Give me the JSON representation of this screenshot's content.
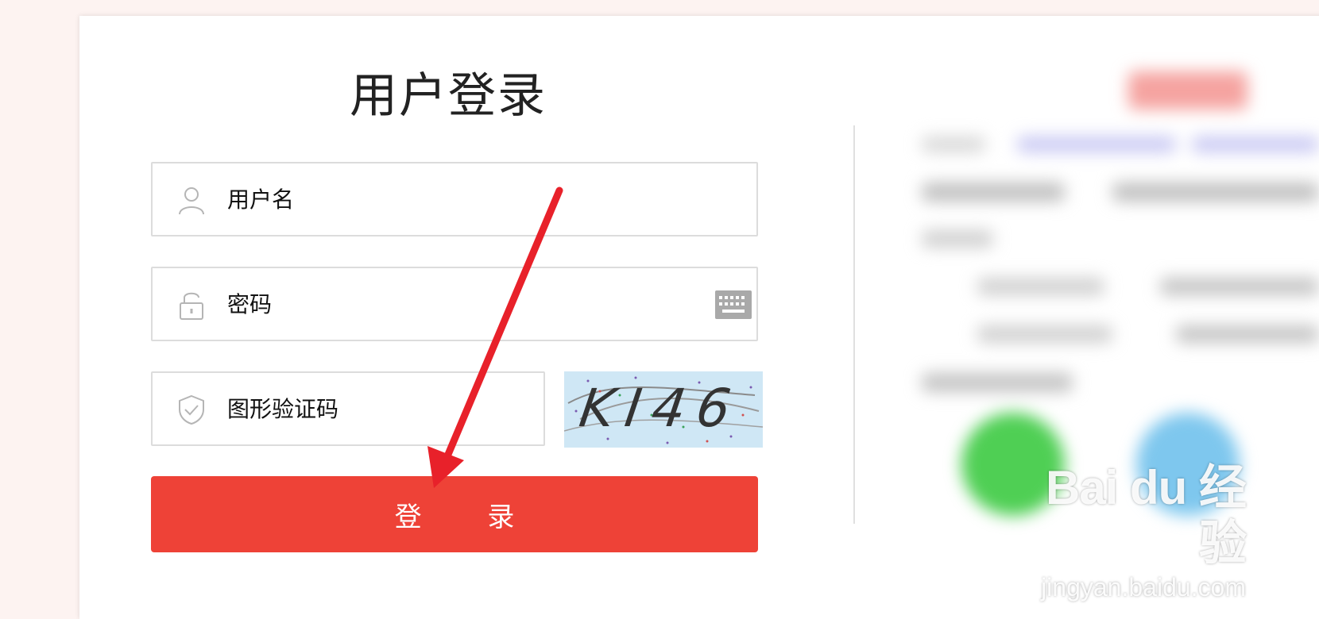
{
  "login": {
    "title": "用户登录",
    "username_placeholder": "用户名",
    "password_placeholder": "密码",
    "captcha_placeholder": "图形验证码",
    "captcha_text": "KI46",
    "submit_label": "登 录"
  },
  "icons": {
    "username": "user-icon",
    "password": "lock-icon",
    "captcha": "shield-check-icon",
    "keyboard": "keyboard-icon"
  },
  "colors": {
    "accent": "#ee4237",
    "annotation_arrow": "#e8212a"
  },
  "watermark": {
    "brand": "Bai du 经验",
    "url": "jingyan.baidu.com"
  }
}
